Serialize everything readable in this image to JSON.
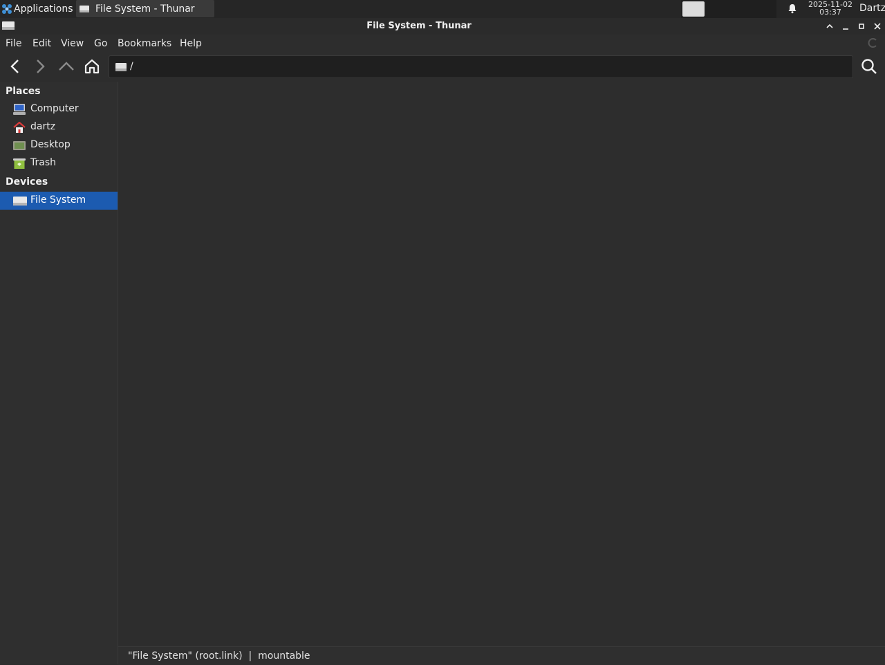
{
  "panel": {
    "applications_label": "Applications",
    "task_label": "File System - Thunar",
    "clock_date": "2025-11-02",
    "clock_time": "03:37",
    "user": "Dartz"
  },
  "window": {
    "title": "File System - Thunar"
  },
  "menubar": {
    "items": [
      "File",
      "Edit",
      "View",
      "Go",
      "Bookmarks",
      "Help"
    ]
  },
  "location": {
    "path": "/"
  },
  "sidebar": {
    "places_title": "Places",
    "places": [
      {
        "label": "Computer",
        "icon": "computer-icon"
      },
      {
        "label": "dartz",
        "icon": "home-folder-icon"
      },
      {
        "label": "Desktop",
        "icon": "desktop-icon"
      },
      {
        "label": "Trash",
        "icon": "trash-icon"
      }
    ],
    "devices_title": "Devices",
    "devices": [
      {
        "label": "File System",
        "icon": "drive-icon",
        "selected": true
      }
    ]
  },
  "status": {
    "text": "\"File System\" (root.link)  |  mountable"
  },
  "colors": {
    "selection": "#1c5bb0",
    "background": "#2d2d2d"
  }
}
